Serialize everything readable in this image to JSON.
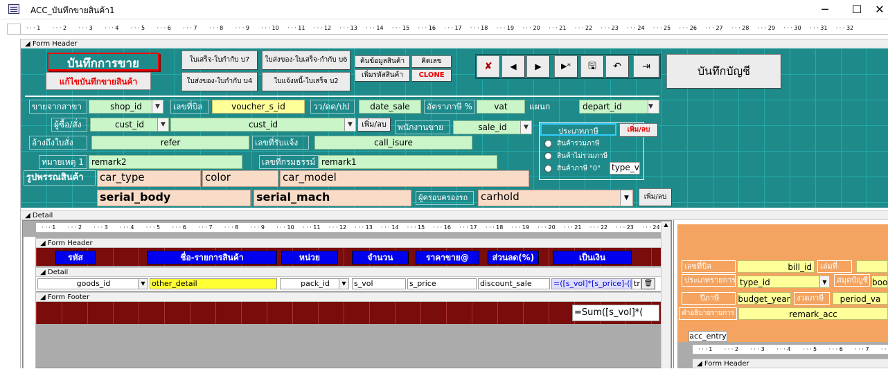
{
  "window": {
    "title": "ACC_บันทึกขายสินค้า1",
    "min": "─",
    "max": "☐",
    "close": "✕"
  },
  "ruler_nums": [
    "1",
    "2",
    "3",
    "4",
    "5",
    "6",
    "7",
    "8",
    "9",
    "10",
    "11",
    "12",
    "13",
    "14",
    "15",
    "16",
    "17",
    "18",
    "19",
    "20",
    "21",
    "22",
    "23",
    "24",
    "25",
    "26",
    "27",
    "28",
    "29",
    "30",
    "31",
    "32"
  ],
  "sub_ruler_nums": [
    "1",
    "2",
    "3",
    "4",
    "5",
    "6",
    "7",
    "8",
    "9",
    "10",
    "11",
    "12",
    "13",
    "14",
    "15",
    "16",
    "17",
    "18",
    "19",
    "20",
    "21",
    "22",
    "23",
    "24"
  ],
  "sections": {
    "form_header": "Form Header",
    "detail": "Detail",
    "sub_form_header": "Form Header",
    "sub_detail": "Detail",
    "sub_form_footer": "Form Footer",
    "right_form_header": "Form Header"
  },
  "header": {
    "title": "บันทึกการขาย",
    "edit_title": "แก้ไขบันทึกขายสินค้า",
    "btn_b7": "ใบเสร็จ-ใบกำกับ บ7",
    "btn_b6": "ใบส่งของ-ใบเสร็จ-กำกับ บ6",
    "btn_b4": "ใบส่งของ-ใบกำกับ บ4",
    "btn_b2": "ใบแจ้งหนี้-ใบเสร็จ บ2",
    "btn_search": "ค้นข้อมูลสินค้า",
    "btn_calc": "คิดเลข",
    "btn_addcode": "เพิ่มรหัสสินค้า",
    "btn_clone": "CLONE",
    "btn_post": "บันทึกบัญชี",
    "branch_label": "ขายจากสาขา",
    "shop_id": "shop_id",
    "bill_label": "เลขที่บิล",
    "voucher": "voucher_s_id",
    "date_label": "วว/ดด/ปป",
    "date_sale": "date_sale",
    "tax_label": "อัตราภาษี %",
    "vat": "vat",
    "dept_label": "แผนก",
    "depart_id": "depart_id",
    "buyer_label": "ผู้ซื้อ/สั่ง",
    "cust_id": "cust_id",
    "cust_id2": "cust_id",
    "add_del": "เพิ่ม/ลบ",
    "staff_label": "พนักงานขาย",
    "sale_id": "sale_id",
    "taxtype_label": "ประเภทภาษี",
    "taxtype_add": "เพิ่ม/ลบ",
    "opt1": "สินค้ารวมภาษี",
    "opt2": "สินค้าไม่รวมภาษี",
    "opt3": "สินค้าภาษี \"0\"",
    "type_va": "type_va",
    "ref_label": "อ้างถึงใบสั่ง",
    "refer": "refer",
    "recv_label": "เลขที่รับแจ้ง",
    "call_isure": "call_isure",
    "remark_label": "หมายเหตุ 1",
    "remark2": "remark2",
    "policy_label": "เลขที่กรมธรรม์",
    "remark1": "remark1",
    "style_label": "รูปพรรณสินค้า",
    "car_type": "car_type",
    "color": "color",
    "car_model": "car_model",
    "serial_body": "serial_body",
    "serial_mach": "serial_mach",
    "owner_label": "ผู้ครอบครองรถ",
    "carhold": "carhold",
    "carhold_add": "เพิ่ม/ลบ"
  },
  "subform": {
    "headers": [
      "รหัส",
      "ชื่อ-รายการสินค้า",
      "หน่วย",
      "จำนวน",
      "ราคาขาย@",
      "ส่วนลด(%)",
      "เป็นเงิน"
    ],
    "goods_id": "goods_id",
    "other_detail": "other_detail",
    "pack_id": "pack_id",
    "s_vol": "s_vol",
    "s_price": "s_price",
    "discount": "discount_sale",
    "formula": "=([s_vol]*[s_price]-([s",
    "tr": "tr",
    "sum": "=Sum([s_vol]*("
  },
  "acc": {
    "bill_label": "เลขที่บิล",
    "bill_id": "bill_id",
    "book_label": "เล่มที่",
    "type_label": "ประเภทรายการ",
    "type_id": "type_id",
    "journal_label": "สมุดบัญชี",
    "book": "book",
    "year_label": "ปีภาษี",
    "budget_year": "budget_year",
    "period_label": "งวดภาษี",
    "period": "period_va",
    "desc_label": "คำอธิบายรายการ",
    "remark_acc": "remark_acc",
    "tab": "acc_entry"
  }
}
